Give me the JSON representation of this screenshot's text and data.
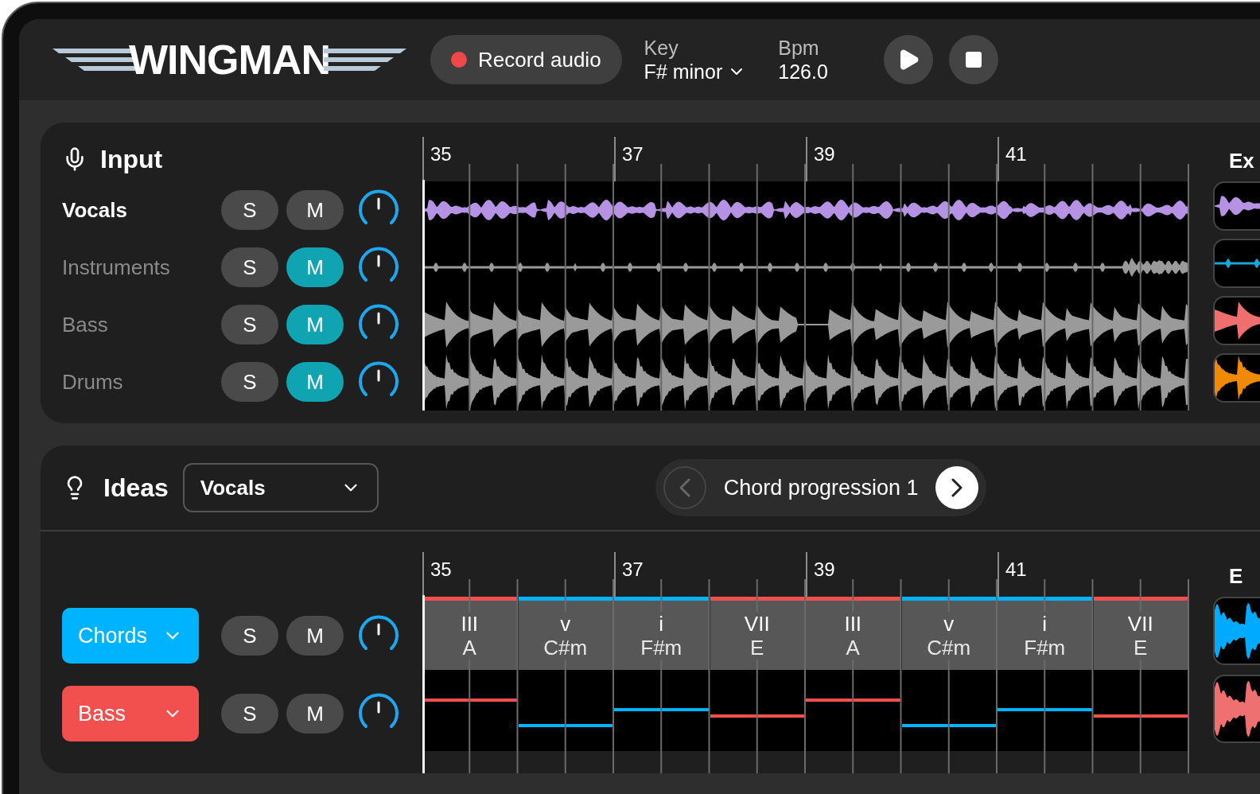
{
  "header": {
    "logo": "WINGMAN",
    "record_button": "Record audio",
    "key": {
      "label": "Key",
      "value": "F# minor"
    },
    "bpm": {
      "label": "Bpm",
      "value": "126.0"
    }
  },
  "input": {
    "title": "Input",
    "ruler": [
      "35",
      "37",
      "39",
      "41"
    ],
    "examples_heading": "Ex",
    "tracks": [
      {
        "name": "Vocals",
        "solo_label": "S",
        "mute_label": "M",
        "solo": false,
        "muted": false,
        "color": "#b592e4"
      },
      {
        "name": "Instruments",
        "solo_label": "S",
        "mute_label": "M",
        "solo": false,
        "muted": true,
        "color": "#9a9a9a"
      },
      {
        "name": "Bass",
        "solo_label": "S",
        "mute_label": "M",
        "solo": false,
        "muted": true,
        "color": "#9a9a9a"
      },
      {
        "name": "Drums",
        "solo_label": "S",
        "mute_label": "M",
        "solo": false,
        "muted": true,
        "color": "#9a9a9a"
      }
    ],
    "examples": [
      {
        "color": "#b592e4"
      },
      {
        "color": "#19a7d6"
      },
      {
        "color": "#ef6e6e"
      },
      {
        "color": "#f08a00"
      }
    ]
  },
  "ideas": {
    "title": "Ideas",
    "source": "Vocals",
    "progression": {
      "label": "Chord progression 1",
      "prev_enabled": false,
      "next_enabled": true
    },
    "ruler": [
      "35",
      "37",
      "39",
      "41"
    ],
    "examples_heading": "E",
    "tracks": [
      {
        "name": "Chords",
        "color": "#00b3ff",
        "solo_label": "S",
        "mute_label": "M",
        "solo": false,
        "muted": false
      },
      {
        "name": "Bass",
        "color": "#f24f4f",
        "solo_label": "S",
        "mute_label": "M",
        "solo": false,
        "muted": false
      }
    ],
    "chords": [
      {
        "numeral": "III",
        "name": "A",
        "color": "#f24f4f"
      },
      {
        "numeral": "v",
        "name": "C#m",
        "color": "#00b3ff"
      },
      {
        "numeral": "i",
        "name": "F#m",
        "color": "#00b3ff"
      },
      {
        "numeral": "VII",
        "name": "E",
        "color": "#f24f4f"
      },
      {
        "numeral": "III",
        "name": "A",
        "color": "#f24f4f"
      },
      {
        "numeral": "v",
        "name": "C#m",
        "color": "#00b3ff"
      },
      {
        "numeral": "i",
        "name": "F#m",
        "color": "#00b3ff"
      },
      {
        "numeral": "VII",
        "name": "E",
        "color": "#f24f4f"
      }
    ],
    "examples": [
      {
        "color": "#00aaff"
      },
      {
        "color": "#ef7070"
      }
    ]
  }
}
